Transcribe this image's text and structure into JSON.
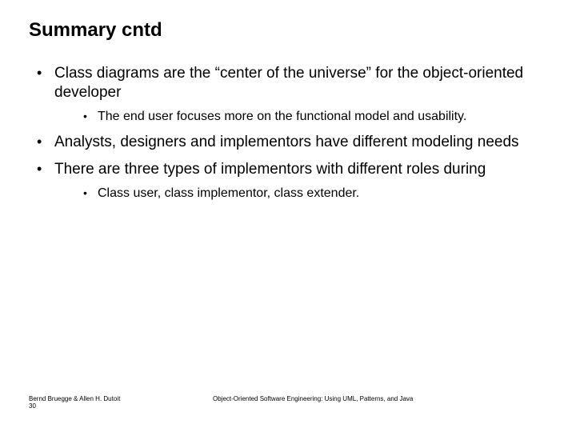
{
  "title": "Summary cntd",
  "b1": "Class diagrams are the “center of the universe” for the object-oriented developer",
  "b1s1": "The end user focuses more on the functional model and usability.",
  "b2": "Analysts, designers and implementors have different modeling needs",
  "b3": "There are three types of implementors with different roles during",
  "b3s1": "Class user, class implementor, class extender.",
  "footer": {
    "authors": "Bernd Bruegge & Allen H. Dutoit",
    "page": "30",
    "book": "Object-Oriented Software Engineering: Using UML, Patterns, and Java"
  }
}
